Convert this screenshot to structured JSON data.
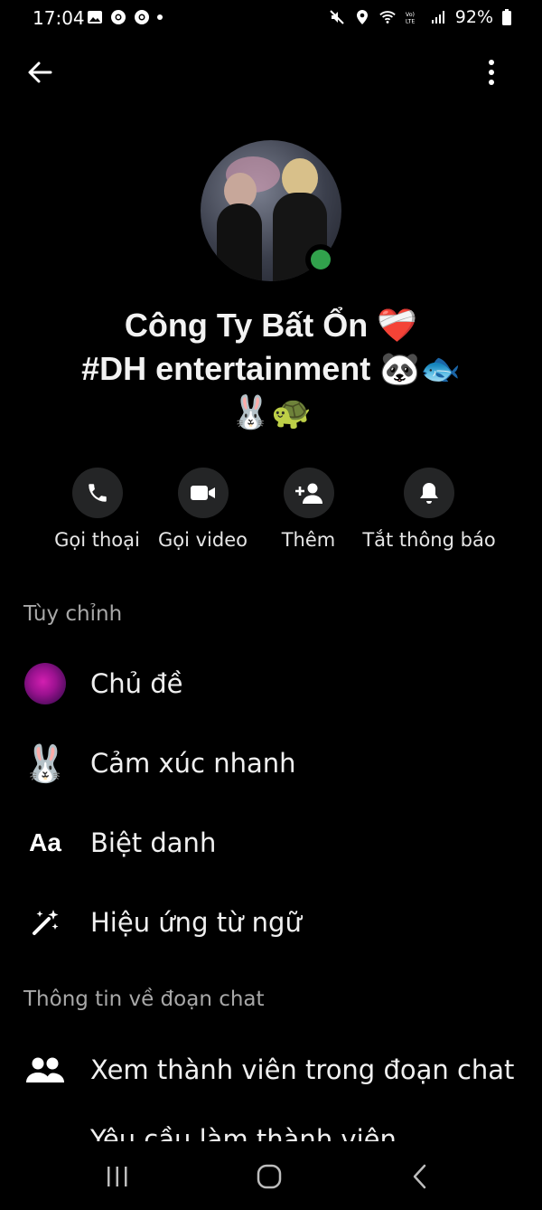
{
  "status_bar": {
    "time": "17:04",
    "battery": "92%",
    "left_icons": [
      "gallery-icon",
      "chrome-icon",
      "chrome-icon",
      "dot-icon"
    ],
    "right_icons": [
      "mute-icon",
      "location-icon",
      "wifi-icon",
      "volte-icon",
      "signal-icon",
      "battery-icon"
    ]
  },
  "header": {
    "back_icon": "arrow-left-icon",
    "more_icon": "more-vertical-icon"
  },
  "profile": {
    "name_line1": "Công Ty Bất Ổn ❤️‍🩹",
    "name_line2": "#DH entertainment 🐼🐟",
    "name_line3": "🐰🐢",
    "online": true
  },
  "actions": [
    {
      "label": "Gọi thoại",
      "icon": "phone-icon"
    },
    {
      "label": "Gọi video",
      "icon": "video-icon"
    },
    {
      "label": "Thêm",
      "icon": "add-person-icon"
    },
    {
      "label": "Tắt thông báo",
      "icon": "bell-icon"
    }
  ],
  "customize": {
    "title": "Tùy chỉnh",
    "items": [
      {
        "label": "Chủ đề",
        "icon": "theme-icon"
      },
      {
        "label": "Cảm xúc nhanh",
        "icon": "rabbit-emoji-icon",
        "emoji": "🐰"
      },
      {
        "label": "Biệt danh",
        "icon": "text-aa-icon",
        "icon_text": "Aa"
      },
      {
        "label": "Hiệu ứng từ ngữ",
        "icon": "magic-wand-icon"
      }
    ]
  },
  "chat_info": {
    "title": "Thông tin về đoạn chat",
    "items": [
      {
        "label": "Xem thành viên trong đoạn chat",
        "icon": "group-icon"
      },
      {
        "label": "Yêu cầu làm thành viên",
        "icon": "member-request-icon"
      }
    ]
  },
  "colors": {
    "background": "#000000",
    "button_bg": "#242526",
    "online_green": "#31a24c",
    "section_title": "#a8a8a8"
  }
}
